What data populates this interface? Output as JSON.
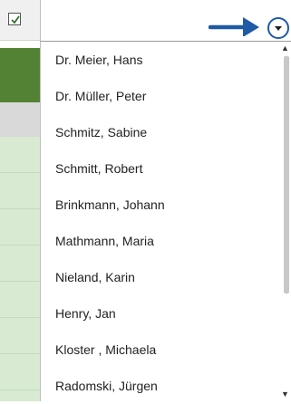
{
  "filter_checkbox": {
    "checked": true,
    "icon": "check-icon"
  },
  "dropdown": {
    "value": "",
    "button_icon": "chevron-down-circle-icon",
    "annotation_icon": "arrow-right-icon",
    "annotation_color": "#1f5aa6"
  },
  "list": {
    "items": [
      {
        "label": "Dr. Meier, Hans"
      },
      {
        "label": "Dr. Müller, Peter"
      },
      {
        "label": "Schmitz, Sabine"
      },
      {
        "label": "Schmitt, Robert"
      },
      {
        "label": "Brinkmann, Johann"
      },
      {
        "label": "Mathmann, Maria"
      },
      {
        "label": "Nieland, Karin"
      },
      {
        "label": "Henry, Jan"
      },
      {
        "label": "Kloster , Michaela"
      },
      {
        "label": "Radomski, Jürgen"
      }
    ]
  },
  "colors": {
    "header_green": "#548235",
    "row_green": "#d8ead2",
    "band_gray": "#d9d9d9",
    "accent_blue": "#1f5aa6"
  }
}
